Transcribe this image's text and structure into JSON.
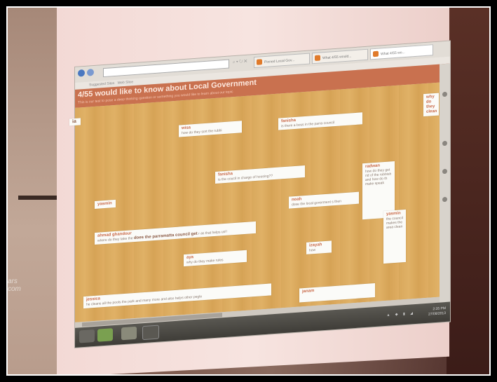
{
  "browser": {
    "tabs": [
      "Pinned Local Gov...",
      "What 4/55 would...",
      "What 4/55 wo..."
    ],
    "fav_labels": [
      "Suggested Sites",
      "Web Slice"
    ]
  },
  "page": {
    "title": "4/55 would like to know about Local Government",
    "subtitle": "This is our test to pose a deep thinking question or something you would like to learn about our topic"
  },
  "notes": [
    {
      "name": "",
      "text": "ia"
    },
    {
      "name": "wisa",
      "text": "how do they sort the rubbi"
    },
    {
      "name": "fanisha",
      "text": "is there a boss in the parra council"
    },
    {
      "name": "",
      "text": "why do they clean"
    },
    {
      "name": "fanisha",
      "text": "is the coucil in charge of housing??"
    },
    {
      "name": "radwan",
      "text": "how do they get rid of the rubbish and how do th make speak"
    },
    {
      "name": "yasmin",
      "text": ""
    },
    {
      "name": "noah",
      "text": "dose the local goverment s then"
    },
    {
      "name": "ahmad ghandour",
      "text": "where do they take the",
      "extra": "does the parramatta council get",
      "tail": "r as that helps us!!"
    },
    {
      "name": "yasmin",
      "text": "the council makes the area clean"
    },
    {
      "name": "aya",
      "text": "why do they make rules"
    },
    {
      "name": "izayah",
      "text": "how"
    },
    {
      "name": "jessica",
      "text": "he cleans all the pools the park and many more and also helps other pegle"
    },
    {
      "name": "janam",
      "text": ""
    }
  ],
  "taskbar": {
    "time": "2:35 PM",
    "date": "27/08/2013"
  },
  "side_text": [
    "ars",
    "com"
  ]
}
